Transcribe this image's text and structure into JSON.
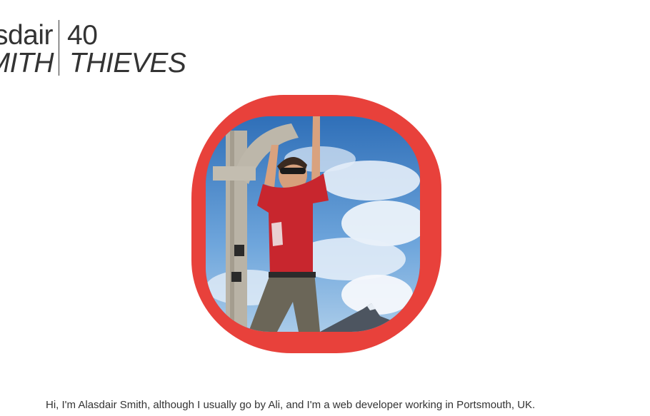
{
  "header": {
    "first_name": "Alasdair",
    "last_name": "Smith",
    "number": "40",
    "word": "Thieves"
  },
  "avatar": {
    "ring_color": "#e8413b"
  },
  "intro": {
    "text": "Hi, I'm Alasdair Smith, although I usually go by Ali, and I'm a web developer working in Portsmouth, UK."
  }
}
